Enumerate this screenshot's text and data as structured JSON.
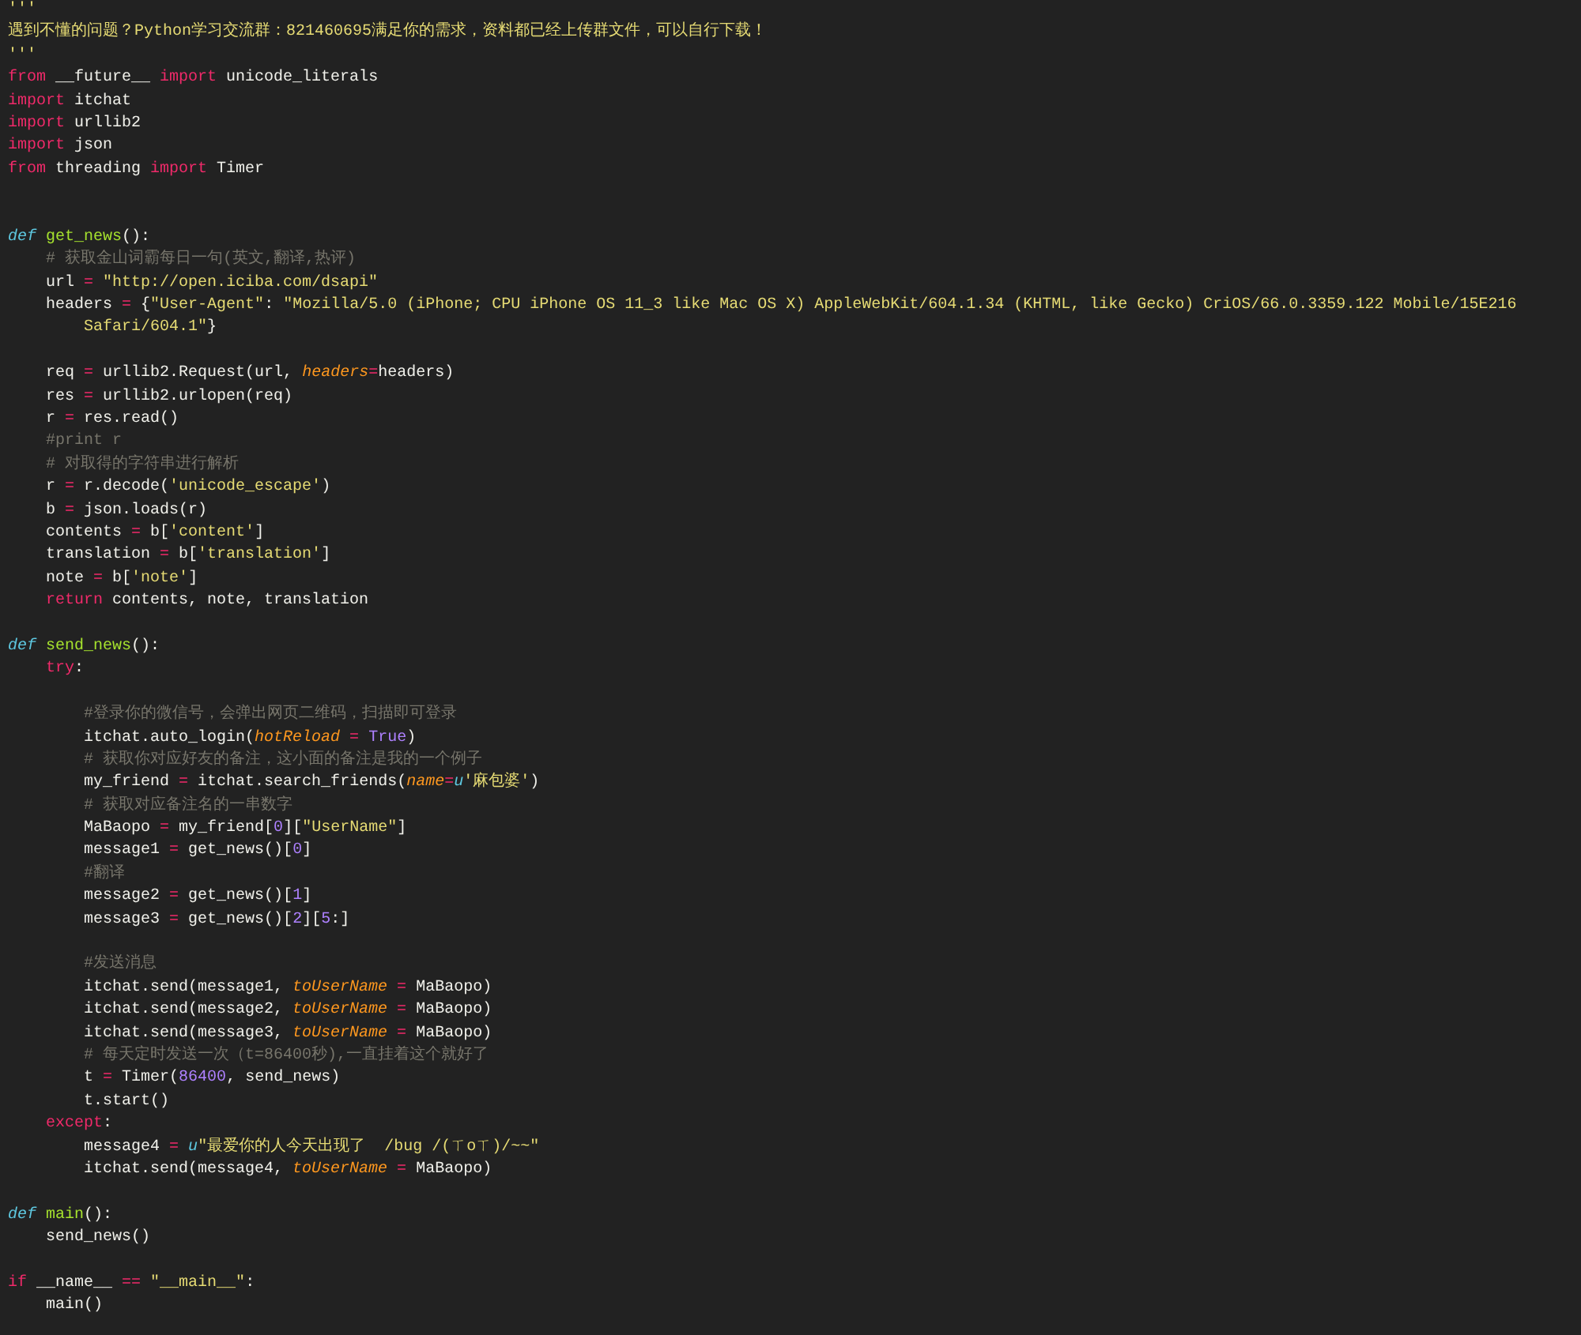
{
  "editor": {
    "lines": [
      {
        "kind": "code",
        "tokens": [
          {
            "kind": "string",
            "text": "'''"
          }
        ]
      },
      {
        "kind": "code",
        "tokens": [
          {
            "kind": "string",
            "text": "遇到不懂的问题？Python学习交流群：821460695满足你的需求，资料都已经上传群文件，可以自行下载！"
          }
        ]
      },
      {
        "kind": "code",
        "tokens": [
          {
            "kind": "string",
            "text": "'''"
          }
        ]
      },
      {
        "kind": "code",
        "tokens": [
          {
            "kind": "keyword",
            "text": "from"
          },
          {
            "kind": "plain",
            "text": " __future__ "
          },
          {
            "kind": "keyword",
            "text": "import"
          },
          {
            "kind": "plain",
            "text": " unicode_literals"
          }
        ]
      },
      {
        "kind": "code",
        "tokens": [
          {
            "kind": "keyword",
            "text": "import"
          },
          {
            "kind": "plain",
            "text": " itchat"
          }
        ]
      },
      {
        "kind": "code",
        "tokens": [
          {
            "kind": "keyword",
            "text": "import"
          },
          {
            "kind": "plain",
            "text": " urllib2"
          }
        ]
      },
      {
        "kind": "code",
        "tokens": [
          {
            "kind": "keyword",
            "text": "import"
          },
          {
            "kind": "plain",
            "text": " json"
          }
        ]
      },
      {
        "kind": "code",
        "tokens": [
          {
            "kind": "keyword",
            "text": "from"
          },
          {
            "kind": "plain",
            "text": " threading "
          },
          {
            "kind": "keyword",
            "text": "import"
          },
          {
            "kind": "plain",
            "text": " Timer"
          }
        ]
      },
      {
        "kind": "blank"
      },
      {
        "kind": "blank"
      },
      {
        "kind": "code",
        "tokens": [
          {
            "kind": "storage",
            "text": "def"
          },
          {
            "kind": "func",
            "text": " get_news"
          },
          {
            "kind": "plain",
            "text": "():"
          }
        ]
      },
      {
        "kind": "code",
        "tokens": [
          {
            "kind": "comment",
            "text": "    # 获取金山词霸每日一句(英文,翻译,热评)"
          }
        ]
      },
      {
        "kind": "code",
        "tokens": [
          {
            "kind": "plain",
            "text": "    url "
          },
          {
            "kind": "op",
            "text": "="
          },
          {
            "kind": "string",
            "text": " \"http://open.iciba.com/dsapi\""
          }
        ]
      },
      {
        "kind": "code",
        "tokens": [
          {
            "kind": "plain",
            "text": "    headers "
          },
          {
            "kind": "op",
            "text": "="
          },
          {
            "kind": "plain",
            "text": " {"
          },
          {
            "kind": "string",
            "text": "\"User-Agent\""
          },
          {
            "kind": "plain",
            "text": ": "
          },
          {
            "kind": "string",
            "text": "\"Mozilla/5.0 (iPhone; CPU iPhone OS 11_3 like Mac OS X) AppleWebKit/604.1.34 (KHTML, like Gecko) CriOS/66.0.3359.122 Mobile/15E216"
          }
        ]
      },
      {
        "kind": "code",
        "tokens": [
          {
            "kind": "string",
            "text": "        Safari/604.1\""
          },
          {
            "kind": "plain",
            "text": "}"
          }
        ]
      },
      {
        "kind": "blank"
      },
      {
        "kind": "code",
        "tokens": [
          {
            "kind": "plain",
            "text": "    req "
          },
          {
            "kind": "op",
            "text": "="
          },
          {
            "kind": "plain",
            "text": " urllib2.Request(url, "
          },
          {
            "kind": "param",
            "text": "headers"
          },
          {
            "kind": "op",
            "text": "="
          },
          {
            "kind": "plain",
            "text": "headers)"
          }
        ]
      },
      {
        "kind": "code",
        "tokens": [
          {
            "kind": "plain",
            "text": "    res "
          },
          {
            "kind": "op",
            "text": "="
          },
          {
            "kind": "plain",
            "text": " urllib2.urlopen(req)"
          }
        ]
      },
      {
        "kind": "code",
        "tokens": [
          {
            "kind": "plain",
            "text": "    r "
          },
          {
            "kind": "op",
            "text": "="
          },
          {
            "kind": "plain",
            "text": " res.read()"
          }
        ]
      },
      {
        "kind": "code",
        "tokens": [
          {
            "kind": "comment",
            "text": "    #print r"
          }
        ]
      },
      {
        "kind": "code",
        "tokens": [
          {
            "kind": "comment",
            "text": "    # 对取得的字符串进行解析"
          }
        ]
      },
      {
        "kind": "code",
        "tokens": [
          {
            "kind": "plain",
            "text": "    r "
          },
          {
            "kind": "op",
            "text": "="
          },
          {
            "kind": "plain",
            "text": " r.decode("
          },
          {
            "kind": "string",
            "text": "'unicode_escape'"
          },
          {
            "kind": "plain",
            "text": ")"
          }
        ]
      },
      {
        "kind": "code",
        "tokens": [
          {
            "kind": "plain",
            "text": "    b "
          },
          {
            "kind": "op",
            "text": "="
          },
          {
            "kind": "plain",
            "text": " json.loads(r)"
          }
        ]
      },
      {
        "kind": "code",
        "tokens": [
          {
            "kind": "plain",
            "text": "    contents "
          },
          {
            "kind": "op",
            "text": "="
          },
          {
            "kind": "plain",
            "text": " b["
          },
          {
            "kind": "string",
            "text": "'content'"
          },
          {
            "kind": "plain",
            "text": "]"
          }
        ]
      },
      {
        "kind": "code",
        "tokens": [
          {
            "kind": "plain",
            "text": "    translation "
          },
          {
            "kind": "op",
            "text": "="
          },
          {
            "kind": "plain",
            "text": " b["
          },
          {
            "kind": "string",
            "text": "'translation'"
          },
          {
            "kind": "plain",
            "text": "]"
          }
        ]
      },
      {
        "kind": "code",
        "tokens": [
          {
            "kind": "plain",
            "text": "    note "
          },
          {
            "kind": "op",
            "text": "="
          },
          {
            "kind": "plain",
            "text": " b["
          },
          {
            "kind": "string",
            "text": "'note'"
          },
          {
            "kind": "plain",
            "text": "]"
          }
        ]
      },
      {
        "kind": "code",
        "tokens": [
          {
            "kind": "keyword",
            "text": "    return"
          },
          {
            "kind": "plain",
            "text": " contents, note, translation"
          }
        ]
      },
      {
        "kind": "blank"
      },
      {
        "kind": "code",
        "tokens": [
          {
            "kind": "storage",
            "text": "def"
          },
          {
            "kind": "func",
            "text": " send_news"
          },
          {
            "kind": "plain",
            "text": "():"
          }
        ]
      },
      {
        "kind": "code",
        "tokens": [
          {
            "kind": "keyword",
            "text": "    try"
          },
          {
            "kind": "plain",
            "text": ":"
          }
        ]
      },
      {
        "kind": "blank"
      },
      {
        "kind": "code",
        "tokens": [
          {
            "kind": "comment",
            "text": "        #登录你的微信号，会弹出网页二维码，扫描即可登录"
          }
        ]
      },
      {
        "kind": "code",
        "tokens": [
          {
            "kind": "plain",
            "text": "        itchat.auto_login("
          },
          {
            "kind": "param",
            "text": "hotReload"
          },
          {
            "kind": "op",
            "text": " = "
          },
          {
            "kind": "const",
            "text": "True"
          },
          {
            "kind": "plain",
            "text": ")"
          }
        ]
      },
      {
        "kind": "code",
        "tokens": [
          {
            "kind": "comment",
            "text": "        # 获取你对应好友的备注，这小面的备注是我的一个例子"
          }
        ]
      },
      {
        "kind": "code",
        "tokens": [
          {
            "kind": "plain",
            "text": "        my_friend "
          },
          {
            "kind": "op",
            "text": "="
          },
          {
            "kind": "plain",
            "text": " itchat.search_friends("
          },
          {
            "kind": "param",
            "text": "name"
          },
          {
            "kind": "op",
            "text": "="
          },
          {
            "kind": "storage",
            "text": "u"
          },
          {
            "kind": "string",
            "text": "'麻包婆'"
          },
          {
            "kind": "plain",
            "text": ")"
          }
        ]
      },
      {
        "kind": "code",
        "tokens": [
          {
            "kind": "comment",
            "text": "        # 获取对应备注名的一串数字"
          }
        ]
      },
      {
        "kind": "code",
        "tokens": [
          {
            "kind": "plain",
            "text": "        MaBaopo "
          },
          {
            "kind": "op",
            "text": "="
          },
          {
            "kind": "plain",
            "text": " my_friend["
          },
          {
            "kind": "number",
            "text": "0"
          },
          {
            "kind": "plain",
            "text": "]["
          },
          {
            "kind": "string",
            "text": "\"UserName\""
          },
          {
            "kind": "plain",
            "text": "]"
          }
        ]
      },
      {
        "kind": "code",
        "tokens": [
          {
            "kind": "plain",
            "text": "        message1 "
          },
          {
            "kind": "op",
            "text": "="
          },
          {
            "kind": "plain",
            "text": " get_news()["
          },
          {
            "kind": "number",
            "text": "0"
          },
          {
            "kind": "plain",
            "text": "]"
          }
        ]
      },
      {
        "kind": "code",
        "tokens": [
          {
            "kind": "comment",
            "text": "        #翻译"
          }
        ]
      },
      {
        "kind": "code",
        "tokens": [
          {
            "kind": "plain",
            "text": "        message2 "
          },
          {
            "kind": "op",
            "text": "="
          },
          {
            "kind": "plain",
            "text": " get_news()["
          },
          {
            "kind": "number",
            "text": "1"
          },
          {
            "kind": "plain",
            "text": "]"
          }
        ]
      },
      {
        "kind": "code",
        "tokens": [
          {
            "kind": "plain",
            "text": "        message3 "
          },
          {
            "kind": "op",
            "text": "="
          },
          {
            "kind": "plain",
            "text": " get_news()["
          },
          {
            "kind": "number",
            "text": "2"
          },
          {
            "kind": "plain",
            "text": "]["
          },
          {
            "kind": "number",
            "text": "5"
          },
          {
            "kind": "plain",
            "text": ":]"
          }
        ]
      },
      {
        "kind": "blank"
      },
      {
        "kind": "code",
        "tokens": [
          {
            "kind": "comment",
            "text": "        #发送消息"
          }
        ]
      },
      {
        "kind": "code",
        "tokens": [
          {
            "kind": "plain",
            "text": "        itchat.send(message1, "
          },
          {
            "kind": "param",
            "text": "toUserName"
          },
          {
            "kind": "op",
            "text": " ="
          },
          {
            "kind": "plain",
            "text": " MaBaopo)"
          }
        ]
      },
      {
        "kind": "code",
        "tokens": [
          {
            "kind": "plain",
            "text": "        itchat.send(message2, "
          },
          {
            "kind": "param",
            "text": "toUserName"
          },
          {
            "kind": "op",
            "text": " ="
          },
          {
            "kind": "plain",
            "text": " MaBaopo)"
          }
        ]
      },
      {
        "kind": "code",
        "tokens": [
          {
            "kind": "plain",
            "text": "        itchat.send(message3, "
          },
          {
            "kind": "param",
            "text": "toUserName"
          },
          {
            "kind": "op",
            "text": " ="
          },
          {
            "kind": "plain",
            "text": " MaBaopo)"
          }
        ]
      },
      {
        "kind": "code",
        "tokens": [
          {
            "kind": "comment",
            "text": "        # 每天定时发送一次（t=86400秒),一直挂着这个就好了"
          }
        ]
      },
      {
        "kind": "code",
        "tokens": [
          {
            "kind": "plain",
            "text": "        t "
          },
          {
            "kind": "op",
            "text": "="
          },
          {
            "kind": "plain",
            "text": " Timer("
          },
          {
            "kind": "number",
            "text": "86400"
          },
          {
            "kind": "plain",
            "text": ", send_news)"
          }
        ]
      },
      {
        "kind": "code",
        "tokens": [
          {
            "kind": "plain",
            "text": "        t.start()"
          }
        ]
      },
      {
        "kind": "code",
        "tokens": [
          {
            "kind": "keyword",
            "text": "    except"
          },
          {
            "kind": "plain",
            "text": ":"
          }
        ]
      },
      {
        "kind": "code",
        "tokens": [
          {
            "kind": "plain",
            "text": "        message4 "
          },
          {
            "kind": "op",
            "text": "= "
          },
          {
            "kind": "storage",
            "text": "u"
          },
          {
            "kind": "string",
            "text": "\"最爱你的人今天出现了  /bug /(ㄒoㄒ)/~~\""
          }
        ]
      },
      {
        "kind": "code",
        "tokens": [
          {
            "kind": "plain",
            "text": "        itchat.send(message4, "
          },
          {
            "kind": "param",
            "text": "toUserName"
          },
          {
            "kind": "op",
            "text": " ="
          },
          {
            "kind": "plain",
            "text": " MaBaopo)"
          }
        ]
      },
      {
        "kind": "blank"
      },
      {
        "kind": "code",
        "tokens": [
          {
            "kind": "storage",
            "text": "def"
          },
          {
            "kind": "func",
            "text": " main"
          },
          {
            "kind": "plain",
            "text": "():"
          }
        ]
      },
      {
        "kind": "code",
        "tokens": [
          {
            "kind": "plain",
            "text": "    send_news()"
          }
        ]
      },
      {
        "kind": "blank"
      },
      {
        "kind": "code",
        "tokens": [
          {
            "kind": "keyword",
            "text": "if"
          },
          {
            "kind": "plain",
            "text": " __name__ "
          },
          {
            "kind": "op",
            "text": "=="
          },
          {
            "kind": "string",
            "text": " \"__main__\""
          },
          {
            "kind": "plain",
            "text": ":"
          }
        ]
      },
      {
        "kind": "code",
        "tokens": [
          {
            "kind": "plain",
            "text": "    main()"
          }
        ]
      }
    ]
  }
}
